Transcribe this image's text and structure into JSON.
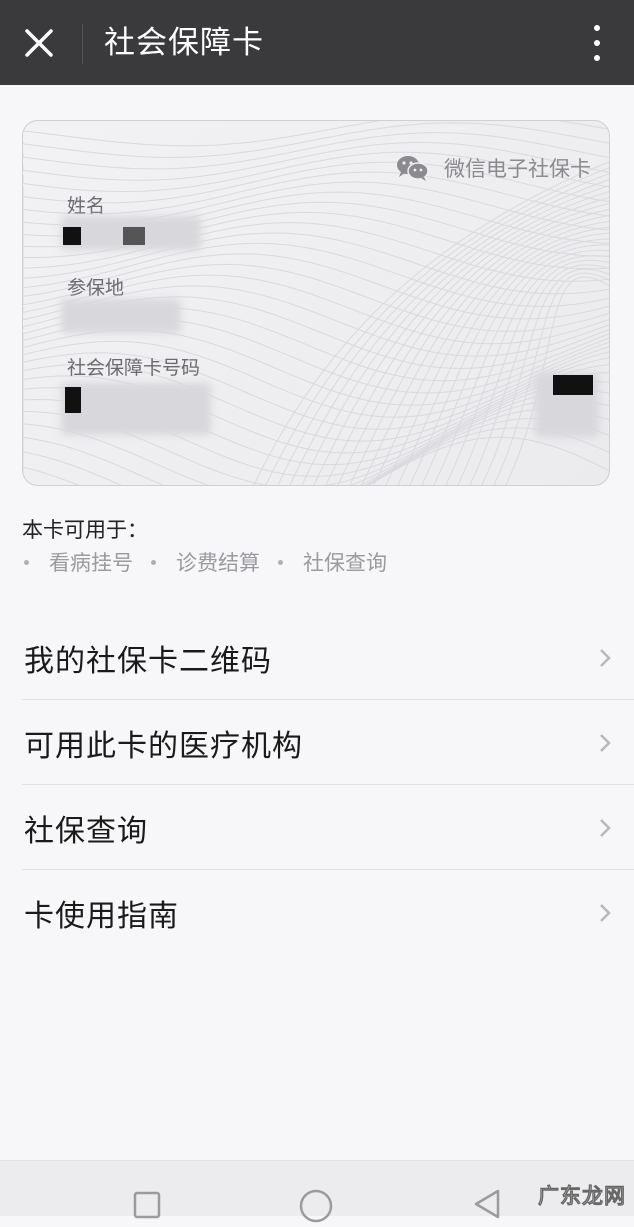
{
  "header": {
    "title": "社会保障卡"
  },
  "card": {
    "brand": "微信电子社保卡",
    "name_label": "姓名",
    "place_label": "参保地",
    "number_label": "社会保障卡号码"
  },
  "usage": {
    "title": "本卡可用于：",
    "items": [
      "看病挂号",
      "诊费结算",
      "社保查询"
    ]
  },
  "menu": {
    "items": [
      {
        "label": "我的社保卡二维码"
      },
      {
        "label": "可用此卡的医疗机构"
      },
      {
        "label": "社保查询"
      },
      {
        "label": "卡使用指南"
      }
    ]
  },
  "watermark": "广东龙网",
  "colors": {
    "header_bg": "#3a3a3c",
    "page_bg": "#f7f7f9",
    "text_muted": "#9a9a9f"
  },
  "icons": [
    "close-icon",
    "more-vertical-icon",
    "wechat-icon",
    "chevron-right-icon",
    "recent-apps-icon",
    "home-icon",
    "back-icon"
  ]
}
